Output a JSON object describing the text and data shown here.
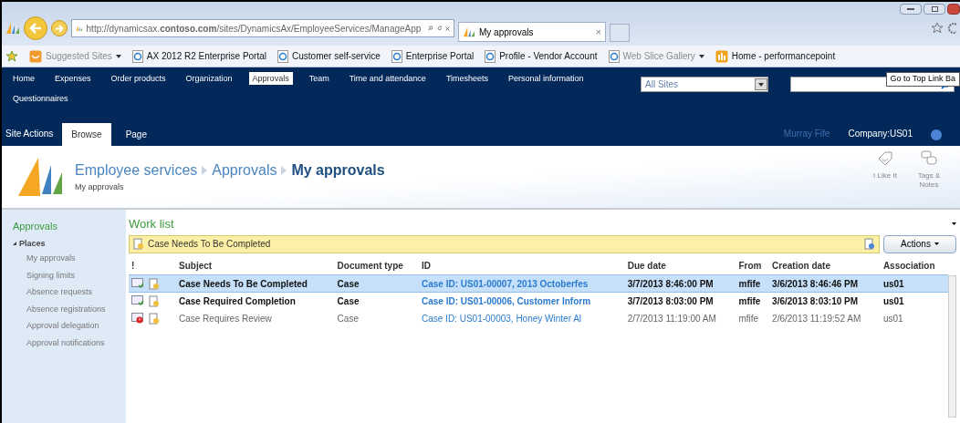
{
  "browser": {
    "address": "http://dynamicsax.**contoso.com**/sites/DynamicsAx/EmployeeServices/ManageApp",
    "tab": {
      "title": "My approvals",
      "close": "×"
    },
    "favorites": [
      {
        "label": "Suggested Sites",
        "dimmed": true,
        "dropdown": true,
        "kind": "suggested"
      },
      {
        "label": "AX 2012 R2 Enterprise Portal",
        "dimmed": false,
        "dropdown": false,
        "kind": "page"
      },
      {
        "label": "Customer self-service",
        "dimmed": false,
        "dropdown": false,
        "kind": "page"
      },
      {
        "label": "Enterprise Portal",
        "dimmed": false,
        "dropdown": false,
        "kind": "page"
      },
      {
        "label": "Profile - Vendor Account",
        "dimmed": false,
        "dropdown": false,
        "kind": "page"
      },
      {
        "label": "Web Slice Gallery",
        "dimmed": true,
        "dropdown": true,
        "kind": "page"
      },
      {
        "label": "Home - performancepoint",
        "dimmed": false,
        "dropdown": false,
        "kind": "site"
      }
    ]
  },
  "top_nav": {
    "items": [
      {
        "label": "Home",
        "selected": false
      },
      {
        "label": "Expenses",
        "selected": false
      },
      {
        "label": "Order products",
        "selected": false
      },
      {
        "label": "Organization",
        "selected": false
      },
      {
        "label": "Approvals",
        "selected": true
      },
      {
        "label": "Team",
        "selected": false
      },
      {
        "label": "Time and attendance",
        "selected": false
      },
      {
        "label": "Timesheets",
        "selected": false
      },
      {
        "label": "Personal information",
        "selected": false
      },
      {
        "label": "Questionnaires",
        "selected": false
      }
    ],
    "search_scope": "All Sites",
    "tooltip": "Go to Top Link Ba"
  },
  "ribbon": {
    "site_actions": "Site Actions",
    "tabs": [
      {
        "label": "Browse",
        "selected": true
      },
      {
        "label": "Page",
        "selected": false
      }
    ],
    "user": "Murray Fife",
    "company": "Company:US01"
  },
  "header": {
    "breadcrumb": [
      "Employee services",
      "Approvals",
      "My approvals"
    ],
    "subtitle": "My approvals",
    "actions": [
      {
        "label": "I Like It",
        "kind": "like"
      },
      {
        "label": "Tags & Notes",
        "kind": "tags"
      }
    ]
  },
  "sidebar": {
    "heading": "Approvals",
    "group": {
      "label": "Places",
      "expanded": true,
      "items": [
        "My approvals",
        "Signing limits",
        "Absence requests",
        "Absence registrations",
        "Approval delegation",
        "Approval notifications"
      ]
    }
  },
  "worklist": {
    "title": "Work list",
    "info_bar": "Case Needs To Be Completed",
    "actions_button": "Actions",
    "flag_header": "!",
    "columns": [
      "Subject",
      "Document type",
      "ID",
      "Due date",
      "From",
      "Creation date",
      "Association"
    ],
    "rows": [
      {
        "kind": "ok",
        "unread": true,
        "selected": true,
        "cells": [
          "Case Needs To Be Completed",
          "Case",
          "Case ID: US01-00007, 2013 Octoberfes",
          "3/7/2013 8:46:00 PM",
          "mfife",
          "3/6/2013 8:46:46 PM",
          "us01"
        ]
      },
      {
        "kind": "ok",
        "unread": true,
        "selected": false,
        "cells": [
          "Case Required Completion",
          "Case",
          "Case ID: US01-00006, Customer Inform",
          "3/7/2013 8:03:00 PM",
          "mfife",
          "3/6/2013 8:03:10 PM",
          "us01"
        ]
      },
      {
        "kind": "error",
        "unread": false,
        "selected": false,
        "cells": [
          "Case Requires Review",
          "Case",
          "Case ID: US01-00003, Honey Winter Al",
          "2/7/2013 11:19:00 AM",
          "mfife",
          "2/6/2013 11:19:52 AM",
          "us01"
        ]
      }
    ]
  }
}
